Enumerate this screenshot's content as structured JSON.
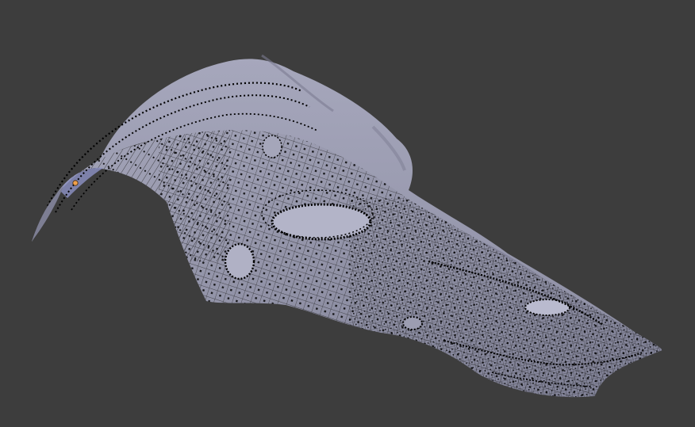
{
  "app": {
    "name": ""
  },
  "viewport": {
    "background": "#3d3d3d",
    "mode": "edit-mode",
    "object": "skull-mesh",
    "colors": {
      "mesh_fill": "#9a9bb0",
      "mesh_shadow": "#6f7085",
      "mesh_highlight": "#b8b9cc",
      "wire": "#141414",
      "vertex": "#000000",
      "active_vertex": "#f0a04a",
      "selected_face_tint": "#8d92c6"
    },
    "icons": [
      "skull-mesh-icon",
      "active-vertex-icon"
    ]
  }
}
